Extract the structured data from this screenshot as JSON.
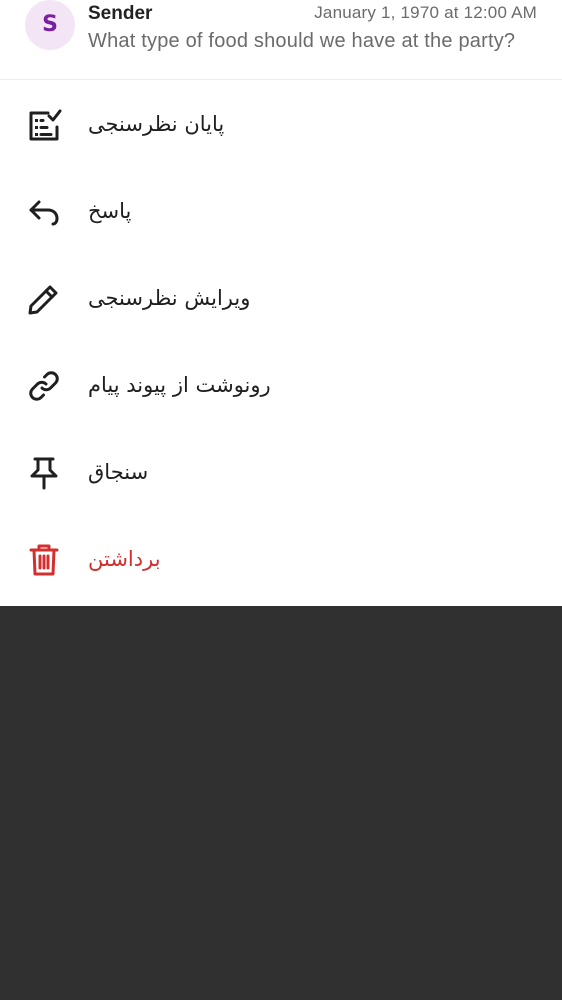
{
  "message": {
    "avatar_letter": "S",
    "sender": "Sender",
    "timestamp": "January 1, 1970 at 12:00 AM",
    "preview": "What type of food should we have at the party?"
  },
  "menu": [
    {
      "label": "پایان نظرسنجی",
      "icon": "end-poll-icon"
    },
    {
      "label": "پاسخ",
      "icon": "reply-icon"
    },
    {
      "label": "ویرایش نظرسنجی",
      "icon": "pencil-icon"
    },
    {
      "label": "رونوشت از پیوند پیام",
      "icon": "link-icon"
    },
    {
      "label": "سنجاق",
      "icon": "pin-icon"
    },
    {
      "label": "برداشتن",
      "icon": "trash-icon"
    }
  ],
  "colors": {
    "danger": "#d32f2f",
    "avatar_bg": "#f3e5f5",
    "avatar_fg": "#7b1fa2",
    "backdrop": "#303030"
  }
}
